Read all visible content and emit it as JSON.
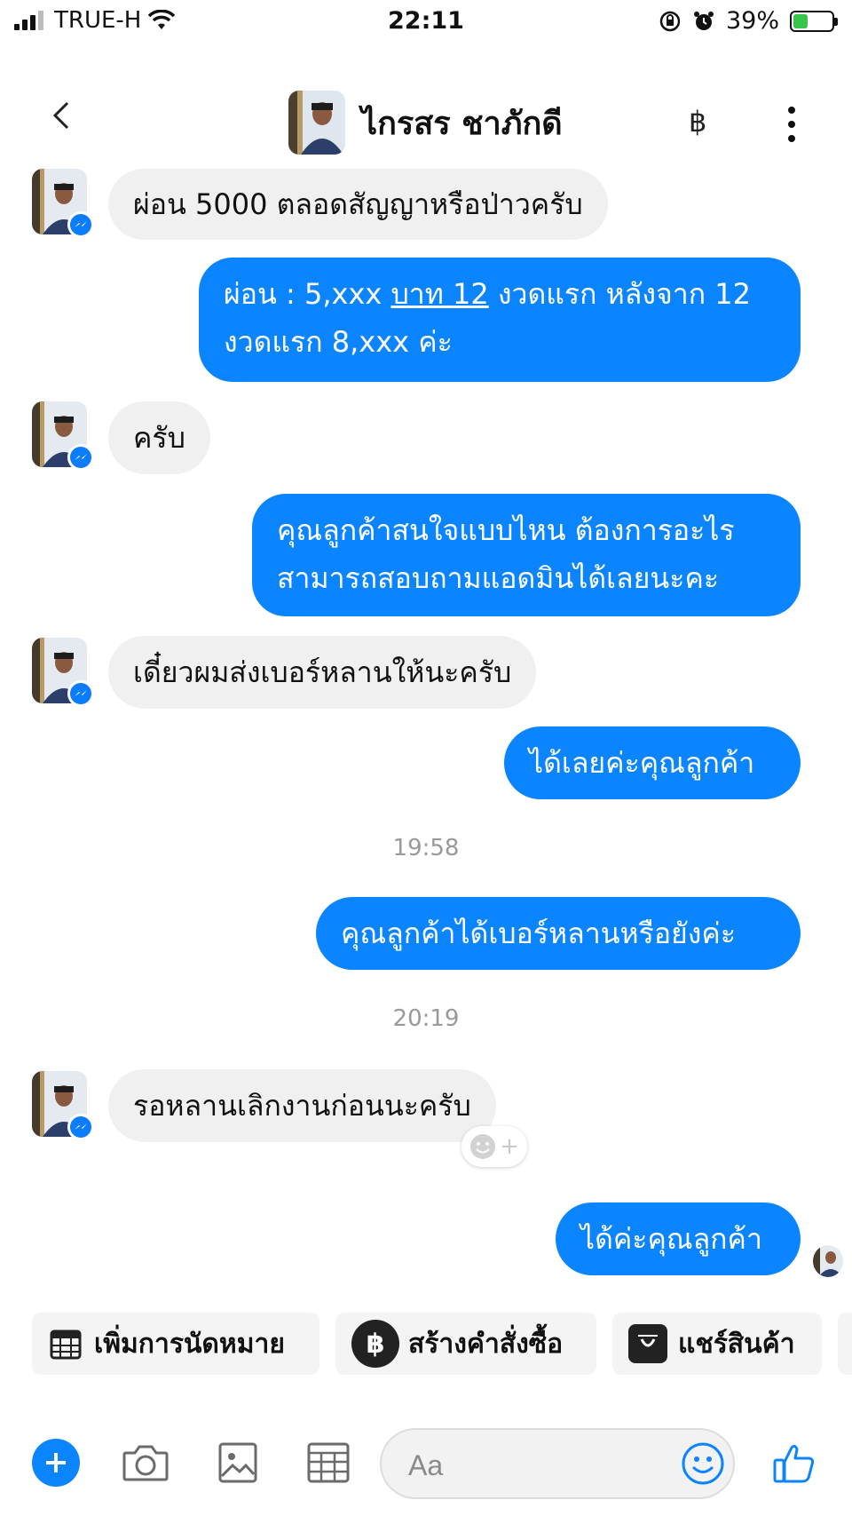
{
  "status_bar": {
    "carrier": "TRUE-H",
    "time": "22:11",
    "battery": "39%",
    "battery_level": 0.39
  },
  "header": {
    "contact_name": "ไกรสร ชาภักดี",
    "baht_symbol": "฿"
  },
  "messages": [
    {
      "side": "in",
      "text": "ผ่อน 5000 ตลอดสัญญาหรือป่าวครับ"
    },
    {
      "side": "out",
      "lines": [
        "ผ่อน : 5,xxx ",
        "บาท 12",
        " งวดแรก หลังจาก 12",
        "งวดแรก  8,xxx ค่ะ"
      ]
    },
    {
      "side": "in",
      "text": "ครับ"
    },
    {
      "side": "out",
      "lines": [
        "คุณลูกค้าสนใจแบบไหน ต้องการอะไร",
        "สามารถสอบถามแอดมินได้เลยนะคะ"
      ]
    },
    {
      "side": "in",
      "text": "เดี๋ยวผมส่งเบอร์หลานให้นะครับ"
    },
    {
      "side": "out",
      "text": "ได้เลยค่ะคุณลูกค้า"
    },
    {
      "side": "out",
      "text": "คุณลูกค้าได้เบอร์หลานหรือยังค่ะ"
    },
    {
      "side": "in",
      "text": "รอหลานเลิกงานก่อนนะครับ"
    },
    {
      "side": "out",
      "text": "ได้ค่ะคุณลูกค้า"
    }
  ],
  "timestamps": [
    "19:58",
    "20:19"
  ],
  "quick_actions": [
    {
      "label": "เพิ่มการนัดหมาย",
      "icon": "calendar-icon"
    },
    {
      "label": "สร้างคำสั่งซื้อ",
      "icon": "baht-icon"
    },
    {
      "label": "แชร์สินค้า",
      "icon": "shopping-bag-icon"
    }
  ],
  "composer": {
    "placeholder": "Aa"
  },
  "colors": {
    "accent": "#0b84ff",
    "incoming_bubble": "#f0f0f1"
  }
}
